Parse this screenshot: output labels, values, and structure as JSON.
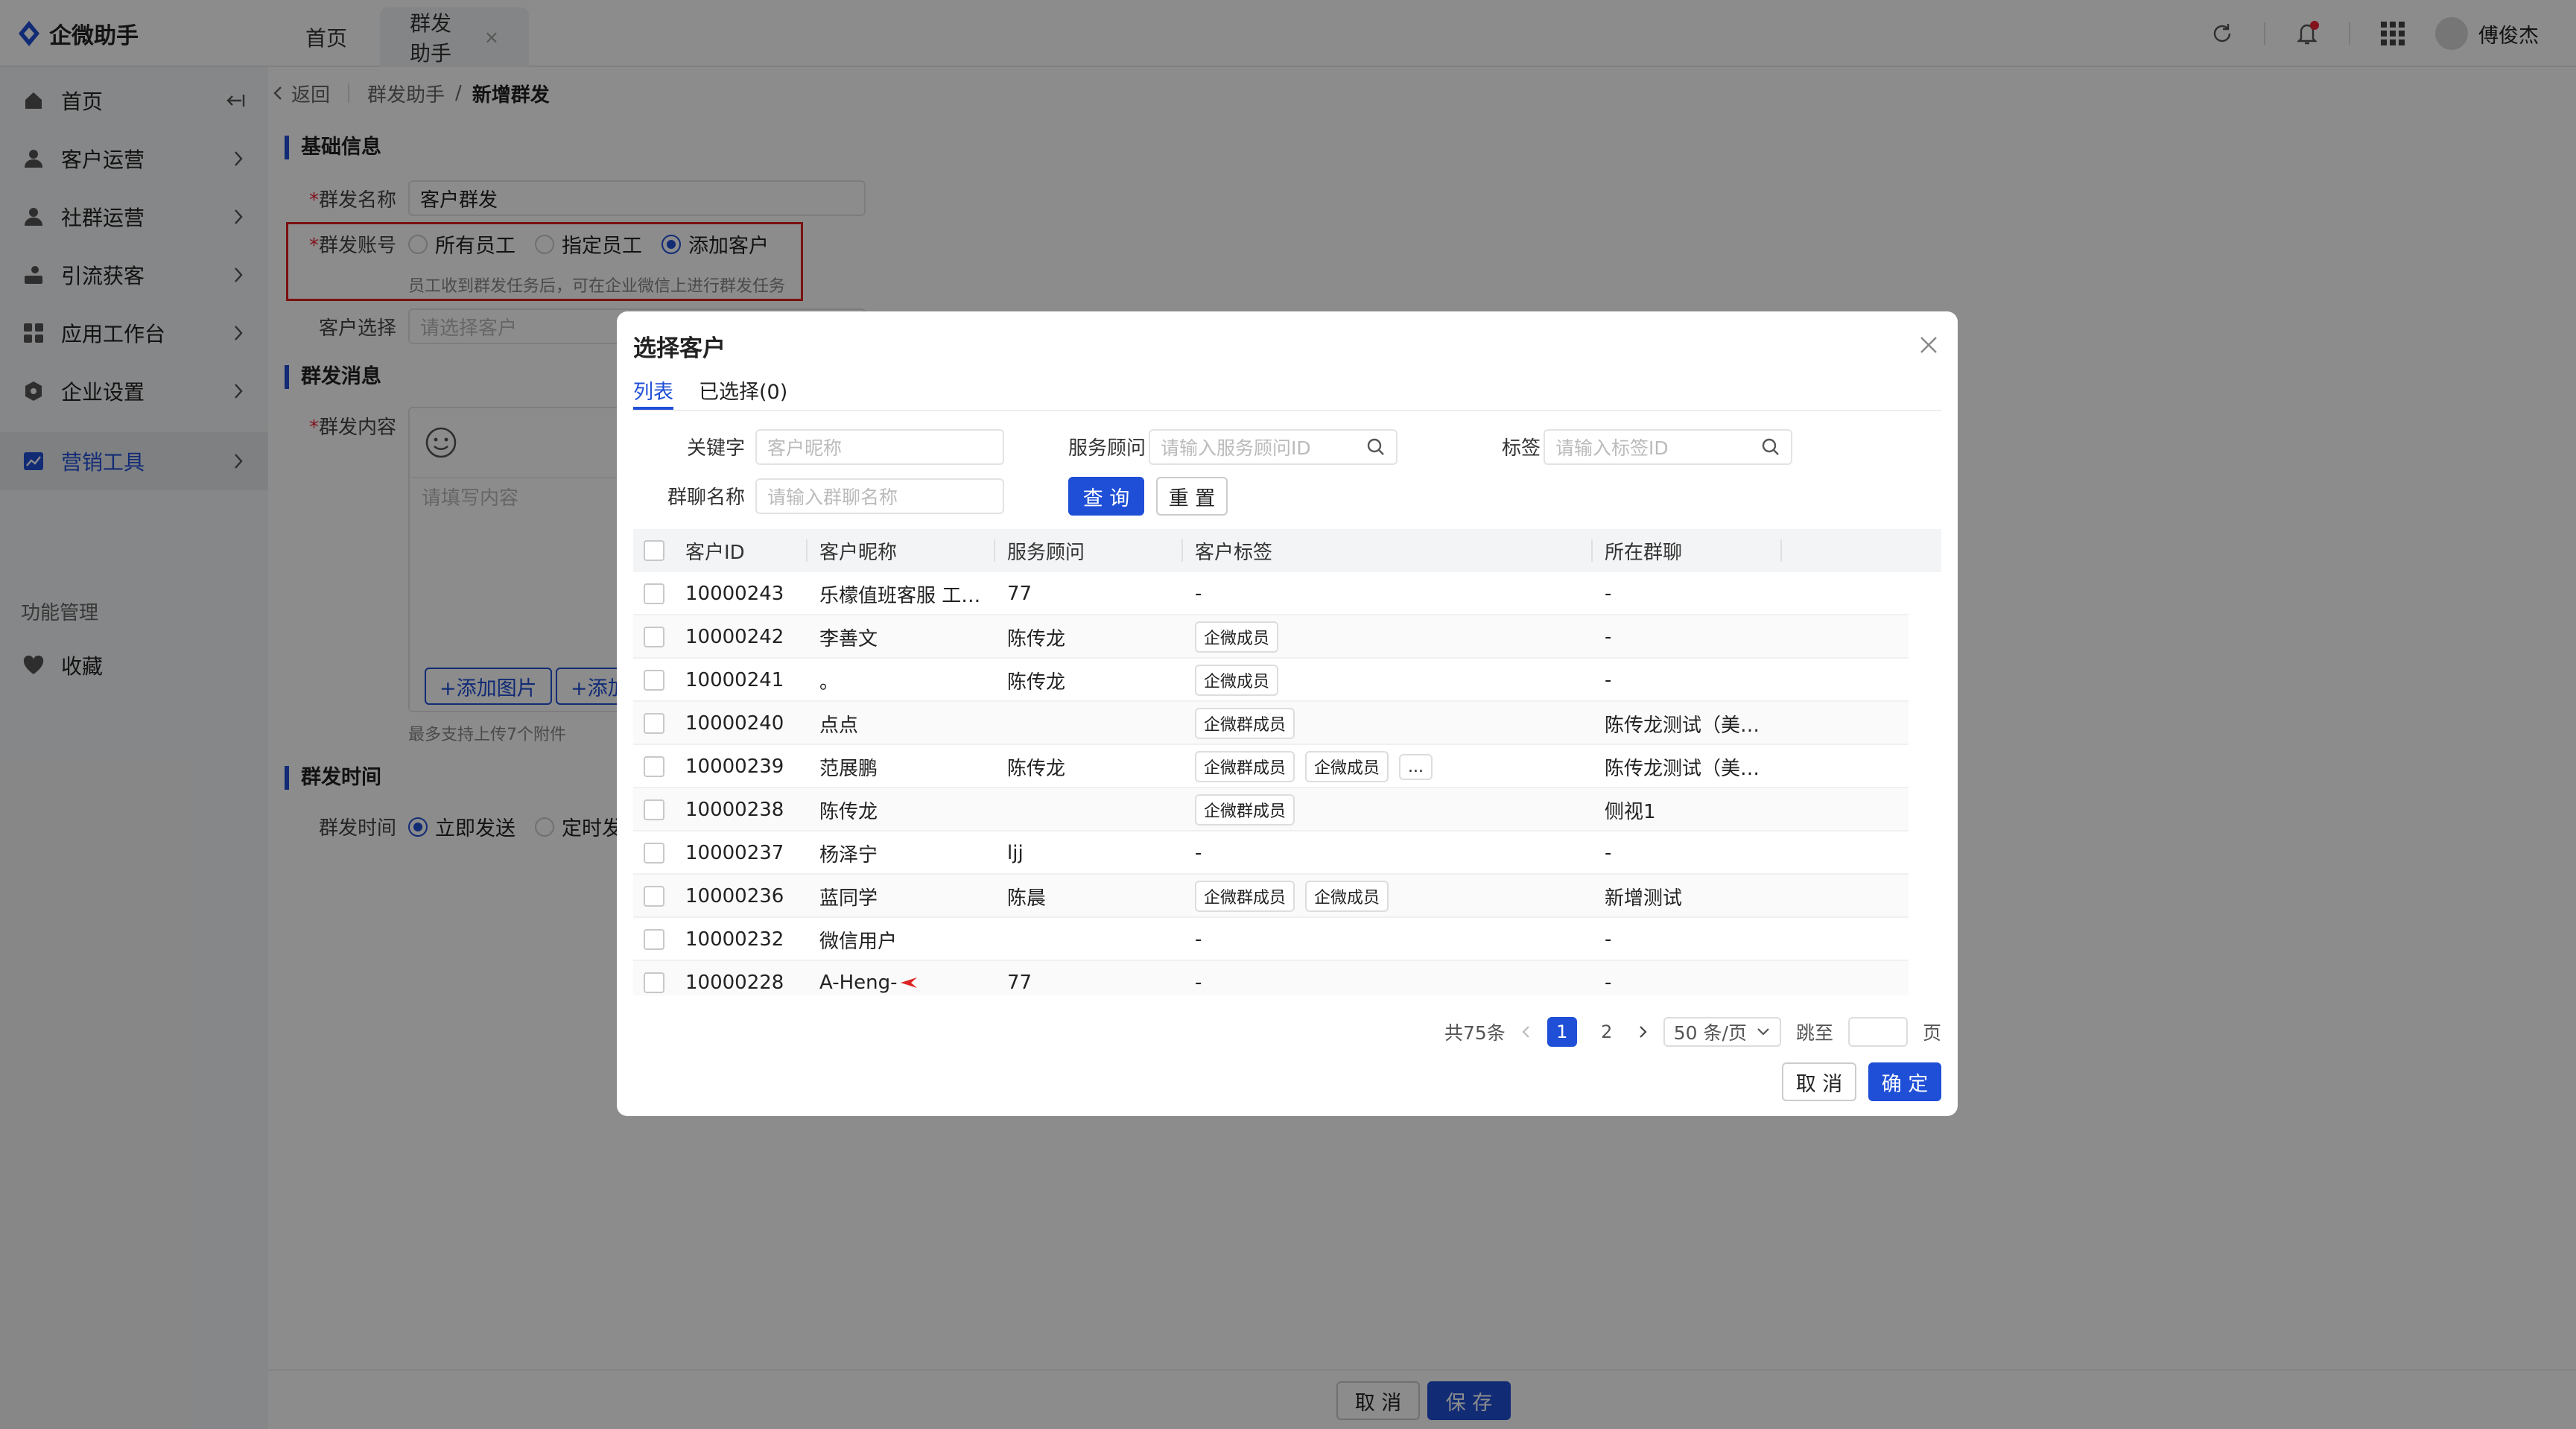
{
  "app": {
    "name": "企微助手"
  },
  "tabs": [
    {
      "label": "首页"
    },
    {
      "label": "群发助手"
    }
  ],
  "user": {
    "name": "傅俊杰"
  },
  "sidebar": {
    "items": [
      {
        "label": "首页",
        "icon": "home-icon"
      },
      {
        "label": "客户运营",
        "icon": "user-icon"
      },
      {
        "label": "社群运营",
        "icon": "group-icon"
      },
      {
        "label": "引流获客",
        "icon": "funnel-icon"
      },
      {
        "label": "应用工作台",
        "icon": "apps-icon"
      },
      {
        "label": "企业设置",
        "icon": "gear-icon"
      },
      {
        "label": "营销工具",
        "icon": "chart-icon",
        "active": true
      }
    ],
    "group_label": "功能管理",
    "favorites": "收藏"
  },
  "breadcrumb": {
    "back": "返回",
    "parent": "群发助手",
    "current": "新增群发"
  },
  "form": {
    "basic_title": "基础信息",
    "name_label": "群发名称",
    "name_value": "客户群发",
    "account_label": "群发账号",
    "account_options": [
      "所有员工",
      "指定员工",
      "添加客户"
    ],
    "account_selected": 2,
    "account_hint": "员工收到群发任务后，可在企业微信上进行群发任务",
    "customer_label": "客户选择",
    "customer_placeholder": "请选择客户",
    "message_title": "群发消息",
    "content_label": "群发内容",
    "content_placeholder": "请填写内容",
    "add_image": "+添加图片",
    "add_more": "+添加",
    "attach_hint": "最多支持上传7个附件",
    "time_title": "群发时间",
    "time_label": "群发时间",
    "time_options": [
      "立即发送",
      "定时发送"
    ],
    "cancel": "取 消",
    "save": "保 存"
  },
  "modal": {
    "title": "选择客户",
    "tabs": [
      "列表",
      "已选择(0)"
    ],
    "search": {
      "keyword_label": "关键字",
      "keyword_placeholder": "客户昵称",
      "advisor_label": "服务顾问",
      "advisor_placeholder": "请输入服务顾问ID",
      "tag_label": "标签",
      "tag_placeholder": "请输入标签ID",
      "group_label": "群聊名称",
      "group_placeholder": "请输入群聊名称",
      "query": "查 询",
      "reset": "重 置"
    },
    "columns": [
      "客户ID",
      "客户昵称",
      "服务顾问",
      "客户标签",
      "所在群聊"
    ],
    "rows": [
      {
        "id": "10000243",
        "nick": "乐檬值班客服 工…",
        "advisor": "77",
        "tags": [],
        "tag_text": "-",
        "group": "-"
      },
      {
        "id": "10000242",
        "nick": "李善文",
        "advisor": "陈传龙",
        "tags": [
          "企微成员"
        ],
        "tag_text": "",
        "group": "-"
      },
      {
        "id": "10000241",
        "nick": "。",
        "advisor": "陈传龙",
        "tags": [
          "企微成员"
        ],
        "tag_text": "",
        "group": "-"
      },
      {
        "id": "10000240",
        "nick": "点点",
        "advisor": "",
        "tags": [
          "企微群成员"
        ],
        "tag_text": "",
        "group": "陈传龙测试（美…"
      },
      {
        "id": "10000239",
        "nick": "范展鹏",
        "advisor": "陈传龙",
        "tags": [
          "企微群成员",
          "企微成员",
          "..."
        ],
        "tag_text": "",
        "group": "陈传龙测试（美…"
      },
      {
        "id": "10000238",
        "nick": "陈传龙",
        "advisor": "",
        "tags": [
          "企微群成员"
        ],
        "tag_text": "",
        "group": "侧视1"
      },
      {
        "id": "10000237",
        "nick": "杨泽宁",
        "advisor": "ljj",
        "tags": [],
        "tag_text": "-",
        "group": "-"
      },
      {
        "id": "10000236",
        "nick": "蓝同学",
        "advisor": "陈晨",
        "tags": [
          "企微群成员",
          "企微成员"
        ],
        "tag_text": "",
        "group": "新增测试"
      },
      {
        "id": "10000232",
        "nick": "微信用户",
        "advisor": "",
        "tags": [],
        "tag_text": "-",
        "group": "-"
      },
      {
        "id": "10000228",
        "nick": "A-Heng-",
        "advisor": "77",
        "tags": [],
        "tag_text": "-",
        "group": "-"
      }
    ],
    "pager": {
      "total": "共75条",
      "pages": [
        "1",
        "2"
      ],
      "size": "50 条/页",
      "jump": "跳至",
      "page_unit": "页"
    },
    "cancel": "取 消",
    "confirm": "确 定"
  },
  "colors": {
    "primary": "#1f4fd6",
    "danger": "#e02020"
  }
}
